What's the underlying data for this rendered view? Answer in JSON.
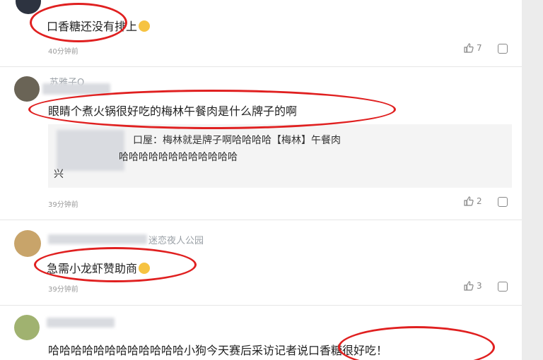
{
  "comments": [
    {
      "text": "口香糖还没有排上",
      "time": "40分钟前",
      "likes": "7"
    },
    {
      "username": "苏雅子Q",
      "text": "眼睛个煮火锅很好吃的梅林午餐肉是什么牌子的啊",
      "time": "39分钟前",
      "likes": "2",
      "reply": {
        "line1": "口屋：梅林就是牌子啊哈哈哈哈【梅林】午餐肉",
        "line2": "哈哈哈哈哈哈哈哈哈哈哈哈",
        "line3": "兴"
      }
    },
    {
      "username_suffix": "迷恋夜人公园",
      "text": "急需小龙虾赞助商",
      "time": "39分钟前",
      "likes": "3"
    },
    {
      "text": "哈哈哈哈哈哈哈哈哈哈哈哈小狗今天赛后采访记者说口香糖很好吃！"
    }
  ],
  "icons": {
    "like": "thumbs-up-icon",
    "reply": "comment-icon",
    "emoji": "smile-emoji-icon"
  },
  "colors": {
    "highlight_circle": "#e02020"
  }
}
